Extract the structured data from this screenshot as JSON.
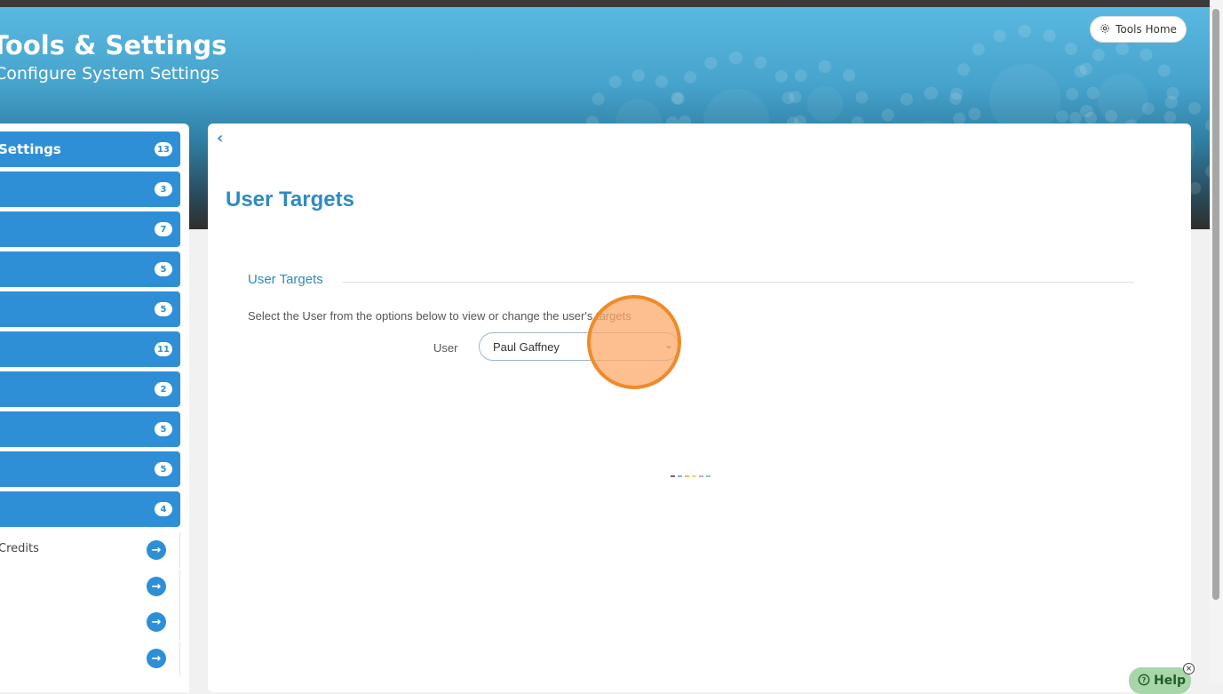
{
  "header": {
    "title": "Tools & Settings",
    "subtitle": "Configure System Settings",
    "tools_home_label": "Tools Home",
    "tools_home_icon": "gear-icon"
  },
  "sidebar": {
    "items": [
      {
        "label": "Settings",
        "badge": "13"
      },
      {
        "label": "",
        "badge": "3"
      },
      {
        "label": "",
        "badge": "7"
      },
      {
        "label": "",
        "badge": "5"
      },
      {
        "label": "",
        "badge": "5"
      },
      {
        "label": "",
        "badge": "11"
      },
      {
        "label": "",
        "badge": "2"
      },
      {
        "label": "",
        "badge": "5"
      },
      {
        "label": "",
        "badge": "5"
      },
      {
        "label": "",
        "badge": "4"
      }
    ],
    "links": [
      {
        "label": "Credits",
        "icon": "arrow-right-icon"
      },
      {
        "label": "",
        "icon": "arrow-right-icon"
      },
      {
        "label": "",
        "icon": "arrow-right-icon"
      },
      {
        "label": "",
        "icon": "arrow-right-icon"
      }
    ]
  },
  "main": {
    "back_icon": "chevron-left-icon",
    "page_title": "User Targets",
    "section_title": "User Targets",
    "instructions": "Select the User from the options below to view or change the user's targets",
    "user_label": "User",
    "user_selected": "Paul Gaffney"
  },
  "help": {
    "label": "Help",
    "icon": "question-circle-icon",
    "close": "×"
  },
  "colors": {
    "accent": "#2e8fd6",
    "title": "#2f8ac4",
    "click_marker": "#f08a2a",
    "loader": [
      "#5b6b8c",
      "#9aa6d8",
      "#f0b37a",
      "#f6d47a",
      "#c7a8e0",
      "#8fc0e8"
    ]
  }
}
